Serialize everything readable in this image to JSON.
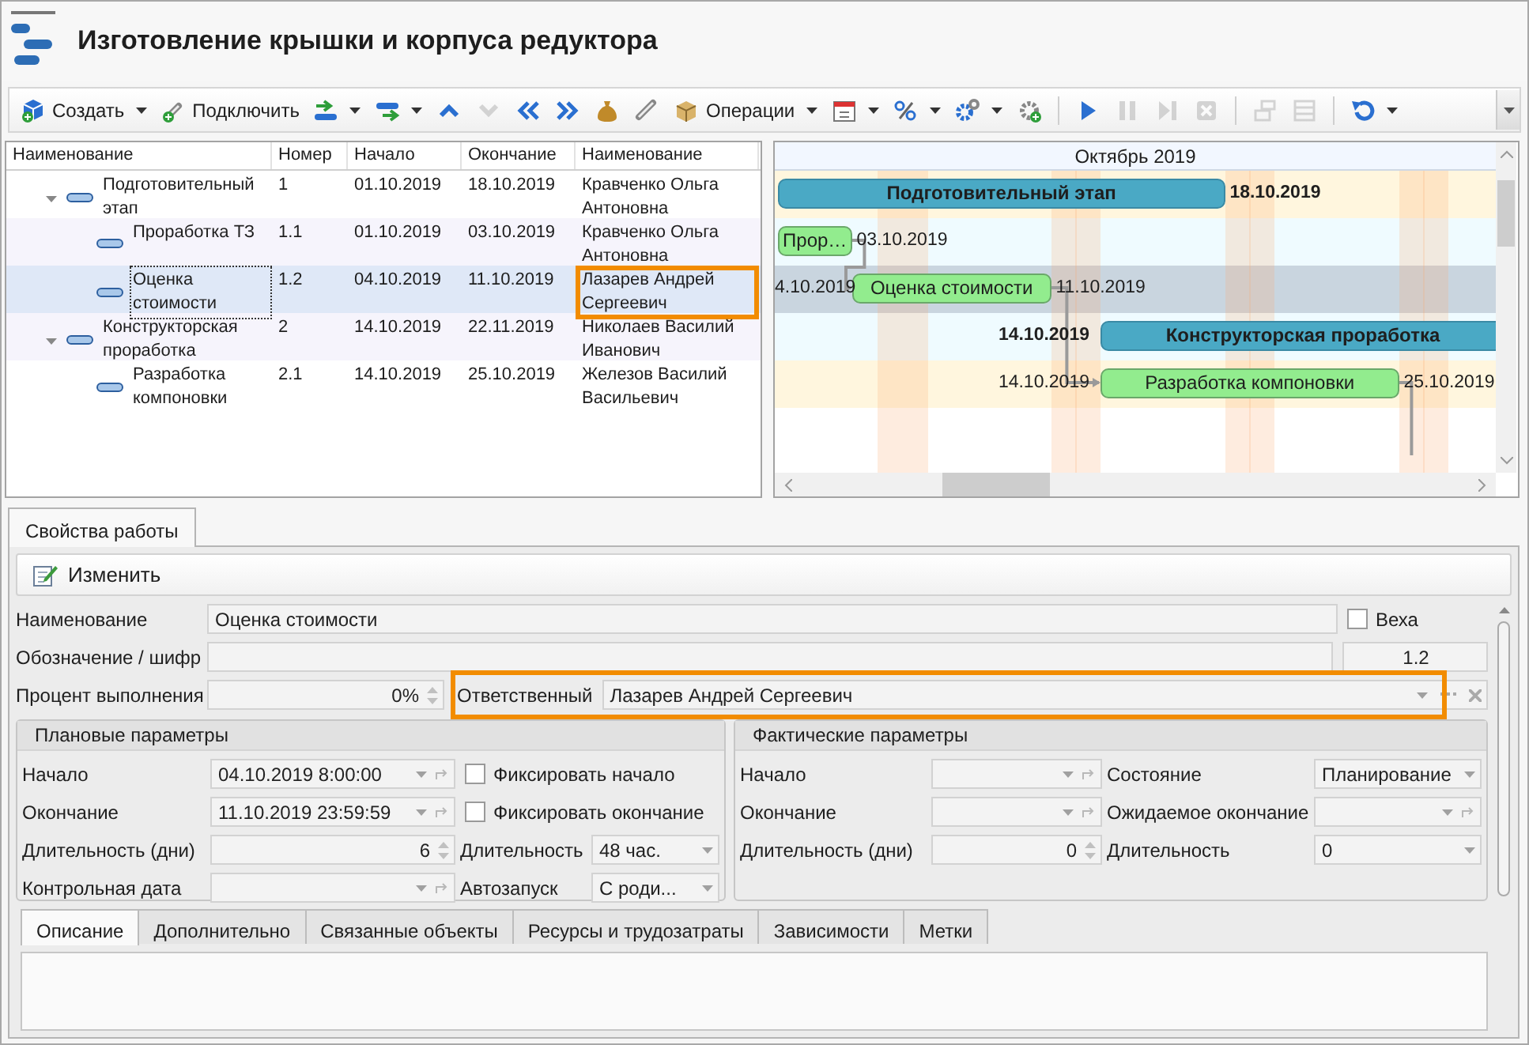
{
  "window": {
    "title": "Изготовление крышки и корпуса редуктора"
  },
  "toolbar": {
    "items": [
      {
        "kind": "button",
        "label": "Создать",
        "menu": true,
        "disabled": false
      },
      {
        "kind": "button",
        "label": "Подключить",
        "menu": false,
        "disabled": false
      },
      {
        "kind": "icon",
        "menu": true,
        "disabled": false
      },
      {
        "kind": "icon",
        "menu": true,
        "disabled": false
      },
      {
        "kind": "icon",
        "menu": false,
        "disabled": false
      },
      {
        "kind": "icon",
        "menu": false,
        "disabled": true
      },
      {
        "kind": "icon",
        "menu": false,
        "disabled": false
      },
      {
        "kind": "icon",
        "menu": false,
        "disabled": false
      },
      {
        "kind": "icon",
        "menu": false,
        "disabled": false
      },
      {
        "kind": "icon",
        "menu": false,
        "disabled": false
      },
      {
        "kind": "button",
        "label": "Операции",
        "menu": true,
        "disabled": false
      },
      {
        "kind": "icon",
        "menu": true,
        "disabled": false
      },
      {
        "kind": "icon",
        "menu": true,
        "disabled": false
      },
      {
        "kind": "icon",
        "menu": true,
        "disabled": false
      },
      {
        "kind": "icon",
        "menu": false,
        "disabled": false
      },
      {
        "kind": "separator"
      },
      {
        "kind": "icon",
        "menu": false,
        "disabled": false
      },
      {
        "kind": "icon",
        "menu": false,
        "disabled": true
      },
      {
        "kind": "icon",
        "menu": false,
        "disabled": true
      },
      {
        "kind": "icon",
        "menu": false,
        "disabled": true
      },
      {
        "kind": "separator"
      },
      {
        "kind": "icon",
        "menu": false,
        "disabled": true
      },
      {
        "kind": "icon",
        "menu": false,
        "disabled": true
      },
      {
        "kind": "separator"
      },
      {
        "kind": "icon",
        "menu": true,
        "disabled": false
      }
    ]
  },
  "tree": {
    "columns": [
      "Наименование",
      "Номер",
      "Начало",
      "Окончание",
      "Наименование"
    ],
    "rows": [
      {
        "name": "Подготовительный этап",
        "number": "1",
        "start": "01.10.2019",
        "end": "18.10.2019",
        "owner": "Кравченко Ольга Антоновна",
        "selected": false,
        "highlighted": false,
        "expanded": true,
        "children": [
          {
            "name": "Проработка ТЗ",
            "number": "1.1",
            "start": "01.10.2019",
            "end": "03.10.2019",
            "owner": "Кравченко Ольга Антоновна",
            "selected": false,
            "highlighted": false
          },
          {
            "name": "Оценка стоимости",
            "number": "1.2",
            "start": "04.10.2019",
            "end": "11.10.2019",
            "owner": "Лазарев Андрей Сергеевич",
            "selected": true,
            "highlighted": true
          }
        ]
      },
      {
        "name": "Конструкторская проработка",
        "number": "2",
        "start": "14.10.2019",
        "end": "22.11.2019",
        "owner": "Николаев Василий Иванович",
        "selected": false,
        "highlighted": false,
        "expanded": true,
        "children": [
          {
            "name": "Разработка компоновки",
            "number": "2.1",
            "start": "14.10.2019",
            "end": "25.10.2019",
            "owner": "Железов Василий Васильевич",
            "selected": false,
            "highlighted": false
          }
        ]
      }
    ]
  },
  "gantt": {
    "month": "Октябрь 2019",
    "bars": [
      {
        "kind": "summary",
        "label": "Подготовительный этап",
        "end_label": "18.10.2019"
      },
      {
        "kind": "task",
        "label": "Прор…",
        "end_label": "03.10.2019"
      },
      {
        "kind": "task",
        "label": "Оценка стоимости",
        "start_label": "4.10.2019",
        "end_label": "11.10.2019"
      },
      {
        "kind": "summary",
        "label": "Конструкторская проработка",
        "start_label": "14.10.2019"
      },
      {
        "kind": "task",
        "label": "Разработка компоновки",
        "start_label": "14.10.2019",
        "end_label": "25.10.2019"
      }
    ],
    "connectors": true
  },
  "properties": {
    "tabs": [
      {
        "label": "Свойства работы",
        "selected": true
      }
    ],
    "edit_button": "Изменить",
    "name": {
      "label": "Наименование",
      "value": "Оценка стоимости"
    },
    "milestone": {
      "label": "Веха",
      "checked": false
    },
    "code": {
      "label": "Обозначение / шифр",
      "number": "1.2"
    },
    "percent": {
      "label": "Процент выполнения",
      "value": "0%"
    },
    "responsible": {
      "label": "Ответственный",
      "value": "Лазарев Андрей Сергеевич",
      "highlighted": true
    },
    "planned": {
      "title": "Плановые параметры",
      "rows": [
        [
          {
            "kind": "date",
            "label": "Начало",
            "value": "04.10.2019 8:00:00"
          },
          {
            "kind": "checkbox",
            "label": "Фиксировать начало",
            "checked": false
          }
        ],
        [
          {
            "kind": "date",
            "label": "Окончание",
            "value": "11.10.2019 23:59:59"
          },
          {
            "kind": "checkbox",
            "label": "Фиксировать окончание",
            "checked": false
          }
        ],
        [
          {
            "kind": "spin",
            "label": "Длительность (дни)",
            "value": "6"
          },
          {
            "kind": "combo",
            "label": "Длительность",
            "value": "48 час."
          }
        ],
        [
          {
            "kind": "date",
            "label": "Контрольная дата"
          },
          {
            "kind": "combo",
            "label": "Автозапуск",
            "value": "С роди..."
          }
        ]
      ]
    },
    "actual": {
      "title": "Фактические параметры",
      "rows": [
        [
          {
            "kind": "date",
            "label": "Начало"
          },
          {
            "kind": "combo",
            "label": "Состояние",
            "value": "Планирование"
          }
        ],
        [
          {
            "kind": "date",
            "label": "Окончание"
          },
          {
            "kind": "date",
            "label": "Ожидаемое окончание"
          }
        ],
        [
          {
            "kind": "spin",
            "label": "Длительность (дни)",
            "value": "0"
          },
          {
            "kind": "combo",
            "label": "Длительность",
            "value": "0"
          }
        ]
      ]
    },
    "detail_tabs": [
      {
        "label": "Описание",
        "selected": true
      },
      {
        "label": "Дополнительно",
        "selected": false
      },
      {
        "label": "Связанные объекты",
        "selected": false
      },
      {
        "label": "Ресурсы и трудозатраты",
        "selected": false
      },
      {
        "label": "Зависимости",
        "selected": false
      },
      {
        "label": "Метки",
        "selected": false
      }
    ]
  }
}
